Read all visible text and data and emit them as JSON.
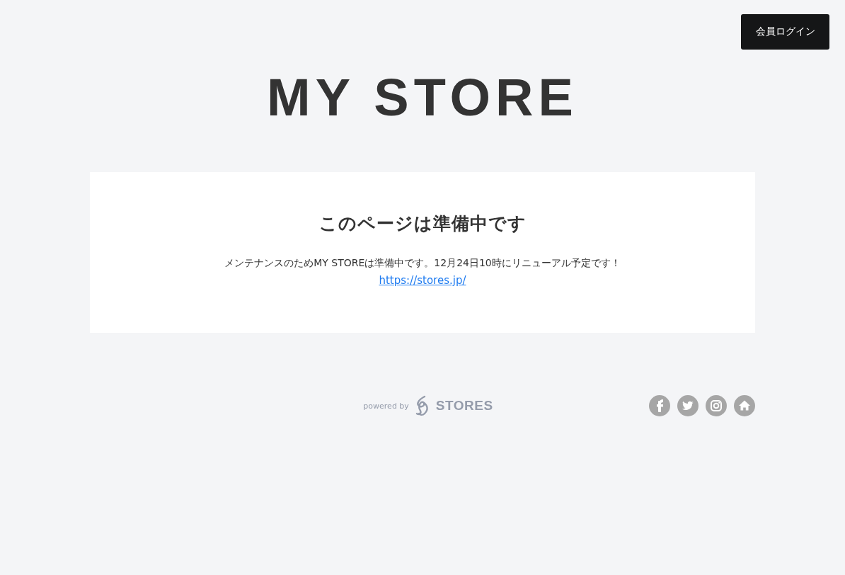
{
  "header": {
    "login_button": "会員ログイン"
  },
  "store_title": "MY STORE",
  "notice": {
    "heading": "このページは準備中です",
    "message": "メンテナンスのためMY STOREは準備中です。12月24日10時にリニューアル予定です！",
    "link": "https://stores.jp/"
  },
  "footer": {
    "powered_by": "powered by",
    "brand": "STORES",
    "social_links": [
      {
        "kind": "facebook"
      },
      {
        "kind": "twitter"
      },
      {
        "kind": "instagram"
      },
      {
        "kind": "home"
      }
    ]
  }
}
